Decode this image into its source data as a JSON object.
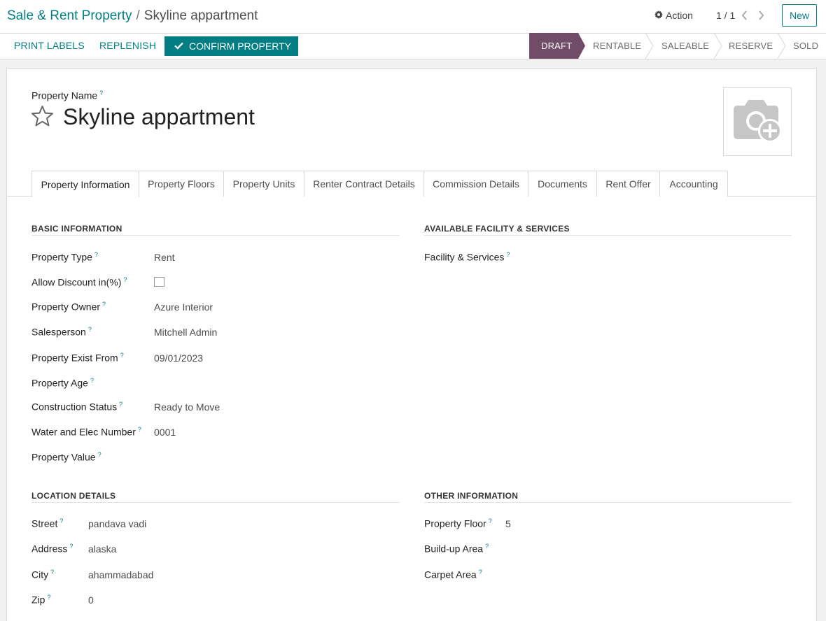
{
  "breadcrumb": {
    "parent": "Sale & Rent Property",
    "separator": "/",
    "current": "Skyline appartment"
  },
  "action_label": "Action",
  "pager": "1 / 1",
  "new_label": "New",
  "header_buttons": {
    "print_labels": "PRINT LABELS",
    "replenish": "REPLENISH",
    "confirm": "CONFIRM PROPERTY"
  },
  "statusbar": [
    "DRAFT",
    "RENTABLE",
    "SALEABLE",
    "RESERVE",
    "SOLD"
  ],
  "statusbar_active": "DRAFT",
  "form": {
    "name_label": "Property Name",
    "name": "Skyline appartment",
    "tabs": [
      "Property Information",
      "Property Floors",
      "Property Units",
      "Renter Contract Details",
      "Commission Details",
      "Documents",
      "Rent Offer",
      "Accounting"
    ],
    "active_tab": "Property Information",
    "basic": {
      "title": "BASIC INFORMATION",
      "fields": [
        {
          "label": "Property Type",
          "value": "Rent"
        },
        {
          "label": "Allow Discount in(%)",
          "value": "unchecked"
        },
        {
          "label": "Property Owner",
          "value": "Azure Interior"
        },
        {
          "label": "Salesperson",
          "value": "Mitchell Admin"
        },
        {
          "label": "Property Exist From",
          "value": "09/01/2023"
        },
        {
          "label": "Property Age",
          "value": ""
        },
        {
          "label": "Construction Status",
          "value": "Ready to Move"
        },
        {
          "label": "Water and Elec Number",
          "value": "0001"
        },
        {
          "label": "Property Value",
          "value": ""
        }
      ]
    },
    "facility": {
      "title": "AVAILABLE FACILITY & SERVICES",
      "fields": [
        {
          "label": "Facility & Services",
          "value": ""
        }
      ]
    },
    "location": {
      "title": "LOCATION DETAILS",
      "fields": [
        {
          "label": "Street",
          "value": "pandava vadi"
        },
        {
          "label": "Address",
          "value": "alaska"
        },
        {
          "label": "City",
          "value": "ahammadabad"
        },
        {
          "label": "Zip",
          "value": "0"
        }
      ]
    },
    "other": {
      "title": "OTHER INFORMATION",
      "fields": [
        {
          "label": "Property Floor",
          "value": "5"
        },
        {
          "label": "Build-up Area",
          "value": ""
        },
        {
          "label": "Carpet Area",
          "value": ""
        }
      ]
    },
    "help_mark": "?"
  },
  "colors": {
    "accent": "#017e84",
    "status_active": "#714b67"
  },
  "icons": [
    "gear-icon",
    "chevron-left-icon",
    "chevron-right-icon",
    "check-icon",
    "star-icon",
    "camera-plus-icon"
  ]
}
